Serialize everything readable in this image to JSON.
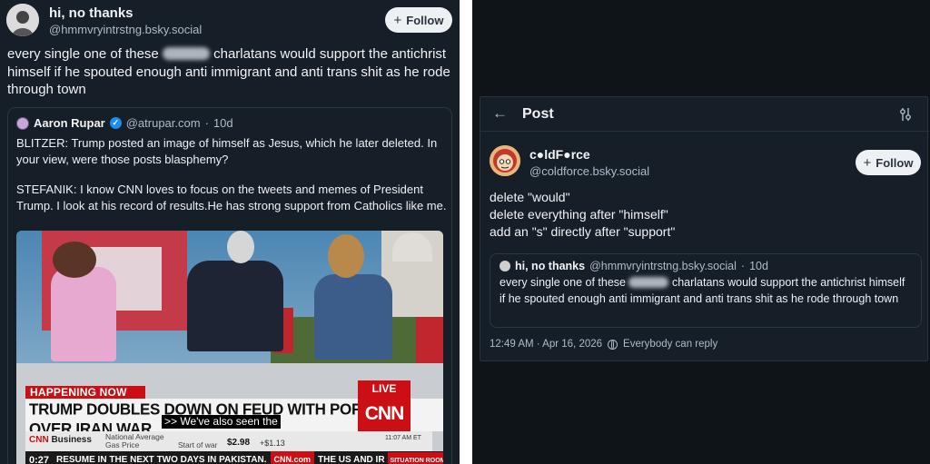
{
  "left_post": {
    "display_name": "hi, no thanks",
    "handle": "@hmmvryintrstng.bsky.social",
    "follow_label": "Follow",
    "text_before": "every single one of these",
    "text_after": "charlatans would support the antichrist himself if he spouted enough anti immigrant and anti trans shit as he rode through town",
    "quoted": {
      "display_name": "Aaron Rupar",
      "handle": "@atrupar.com",
      "age": "10d",
      "para1": "BLITZER: Trump posted an image of himself as Jesus, which he later deleted. In your view, were those posts blasphemy?",
      "para2": "STEFANIK: I know CNN loves to focus on the tweets and memes of President Trump. I look at his record of results.He has strong support from Catholics like me.",
      "video": {
        "happening_now": "HAPPENING NOW",
        "headline": "TRUMP DOUBLES DOWN ON FEUD WITH POPE LEO OVER IRAN WAR",
        "live": "LIVE",
        "network": "CNN",
        "caption": ">> We've also seen the",
        "ticker_brand": "CNN",
        "ticker_brand_sub": "Business",
        "ticker_item1": "National Average Gas Price",
        "ticker_item2": "Start of war",
        "ticker_value": "$2.98",
        "ticker_delta": "+$1.13",
        "ticker_time": "11:07 AM ET",
        "timecode": "0:27",
        "crawl_text": "RESUME IN THE NEXT TWO DAYS IN PAKISTAN.",
        "crawl_site": "CNN.com",
        "crawl_text2": "THE US AND IR",
        "crawl_sitroom": "SITUATION ROOM"
      }
    }
  },
  "right_post": {
    "header_title": "Post",
    "display_name": "c●ldF●rce",
    "handle": "@coldforce.bsky.social",
    "follow_label": "Follow",
    "line1": "delete \"would\"",
    "line2": "delete everything after \"himself\"",
    "line3": "add an \"s\" directly after \"support\"",
    "quoted": {
      "display_name": "hi, no thanks",
      "handle": "@hmmvryintrstng.bsky.social",
      "age": "10d",
      "text_before": "every single one of these",
      "text_after": "charlatans would support the antichrist himself if he spouted enough anti immigrant and anti trans shit as he rode through town"
    },
    "timestamp": "12:49 AM · Apr 16, 2026",
    "reply_setting": "Everybody can reply"
  },
  "colors": {
    "left_bg": "#161e27",
    "right_bg": "#0f1419",
    "cnn_red": "#cc0f15",
    "verified_blue": "#1d8cf0"
  }
}
